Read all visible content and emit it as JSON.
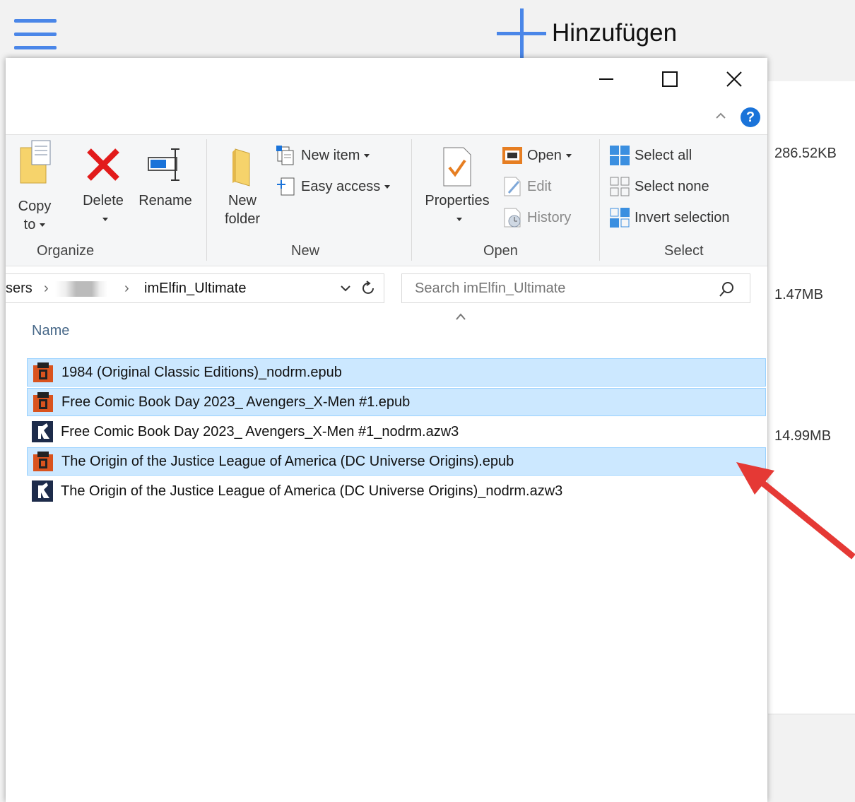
{
  "background_app": {
    "add_label": "Hinzufügen",
    "sizes": [
      "286.52KB",
      "1.47MB",
      "14.99MB"
    ]
  },
  "ribbon": {
    "organize": {
      "label": "Organize",
      "copy_to": [
        "Copy",
        "to"
      ],
      "delete": "Delete",
      "rename": "Rename"
    },
    "new": {
      "label": "New",
      "new_folder": [
        "New",
        "folder"
      ],
      "new_item": "New item",
      "easy_access": "Easy access"
    },
    "open": {
      "label": "Open",
      "properties": "Properties",
      "open": "Open",
      "edit": "Edit",
      "history": "History"
    },
    "select": {
      "label": "Select",
      "select_all": "Select all",
      "select_none": "Select none",
      "invert_selection": "Invert selection"
    },
    "help": "?"
  },
  "address": {
    "crumb_prefix": "sers",
    "current_folder": "imElfin_Ultimate"
  },
  "search": {
    "placeholder": "Search imElfin_Ultimate"
  },
  "columns": {
    "name": "Name"
  },
  "files": [
    {
      "name": "1984 (Original Classic Editions)_nodrm.epub",
      "icon": "epub-icon",
      "selected": true
    },
    {
      "name": "Free Comic Book Day 2023_ Avengers_X-Men #1.epub",
      "icon": "epub-icon",
      "selected": true
    },
    {
      "name": "Free Comic Book Day 2023_ Avengers_X-Men #1_nodrm.azw3",
      "icon": "kindle-icon",
      "selected": false
    },
    {
      "name": "The Origin of the Justice League of America (DC Universe Origins).epub",
      "icon": "epub-icon",
      "selected": true
    },
    {
      "name": "The Origin of the Justice League of America (DC Universe Origins)_nodrm.azw3",
      "icon": "kindle-icon",
      "selected": false
    }
  ],
  "colors": {
    "accent": "#4a86e8",
    "selection": "#cce8ff",
    "arrow": "#e53935"
  }
}
